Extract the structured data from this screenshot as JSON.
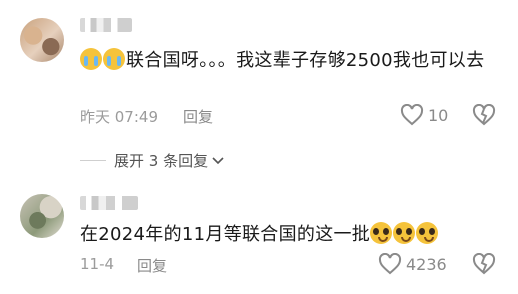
{
  "comments": [
    {
      "text": "联合国呀。。。我这辈子存够2500我也可以去",
      "time": "昨天 07:49",
      "reply_label": "回复",
      "like_count": "10",
      "leading_emojis": [
        "loudly-crying-face",
        "loudly-crying-face"
      ]
    },
    {
      "text": "在2024年的11月等联合国的这一批",
      "time": "11-4",
      "reply_label": "回复",
      "like_count": "4236",
      "trailing_emojis": [
        "pleading-face",
        "pleading-face",
        "pleading-face"
      ]
    }
  ],
  "expand_replies": "展开 3 条回复",
  "colors": {
    "text": "#1a1a1a",
    "meta": "#9b9b9b",
    "emoji": "#f5c33b"
  }
}
